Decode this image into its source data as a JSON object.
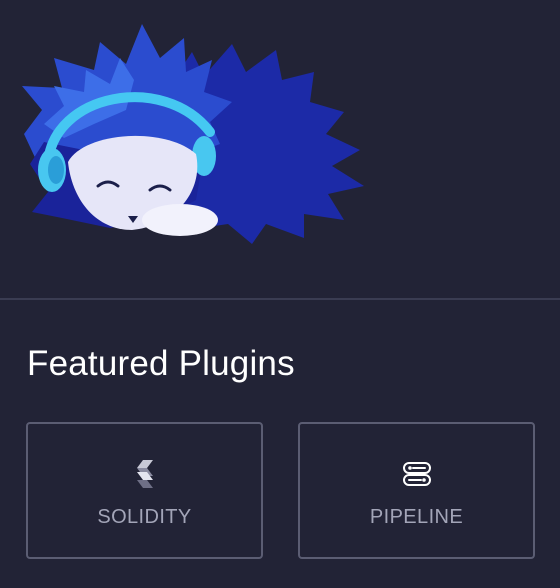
{
  "hero": {
    "mascot_icon": "hedgehog-mascot-with-headphones"
  },
  "featured": {
    "title": "Featured Plugins",
    "plugins": [
      {
        "label": "SOLIDITY",
        "icon": "solidity-icon"
      },
      {
        "label": "PIPELINE",
        "icon": "pipeline-icon"
      }
    ]
  },
  "colors": {
    "background": "#222336",
    "divider": "#3a3c52",
    "card_border": "#5b5d73",
    "card_text": "#a3a5b8",
    "mascot_dark_blue": "#1c2aa7",
    "mascot_blue": "#2f59d6",
    "mascot_cyan": "#42c3f0",
    "mascot_face": "#e6e6f8"
  }
}
